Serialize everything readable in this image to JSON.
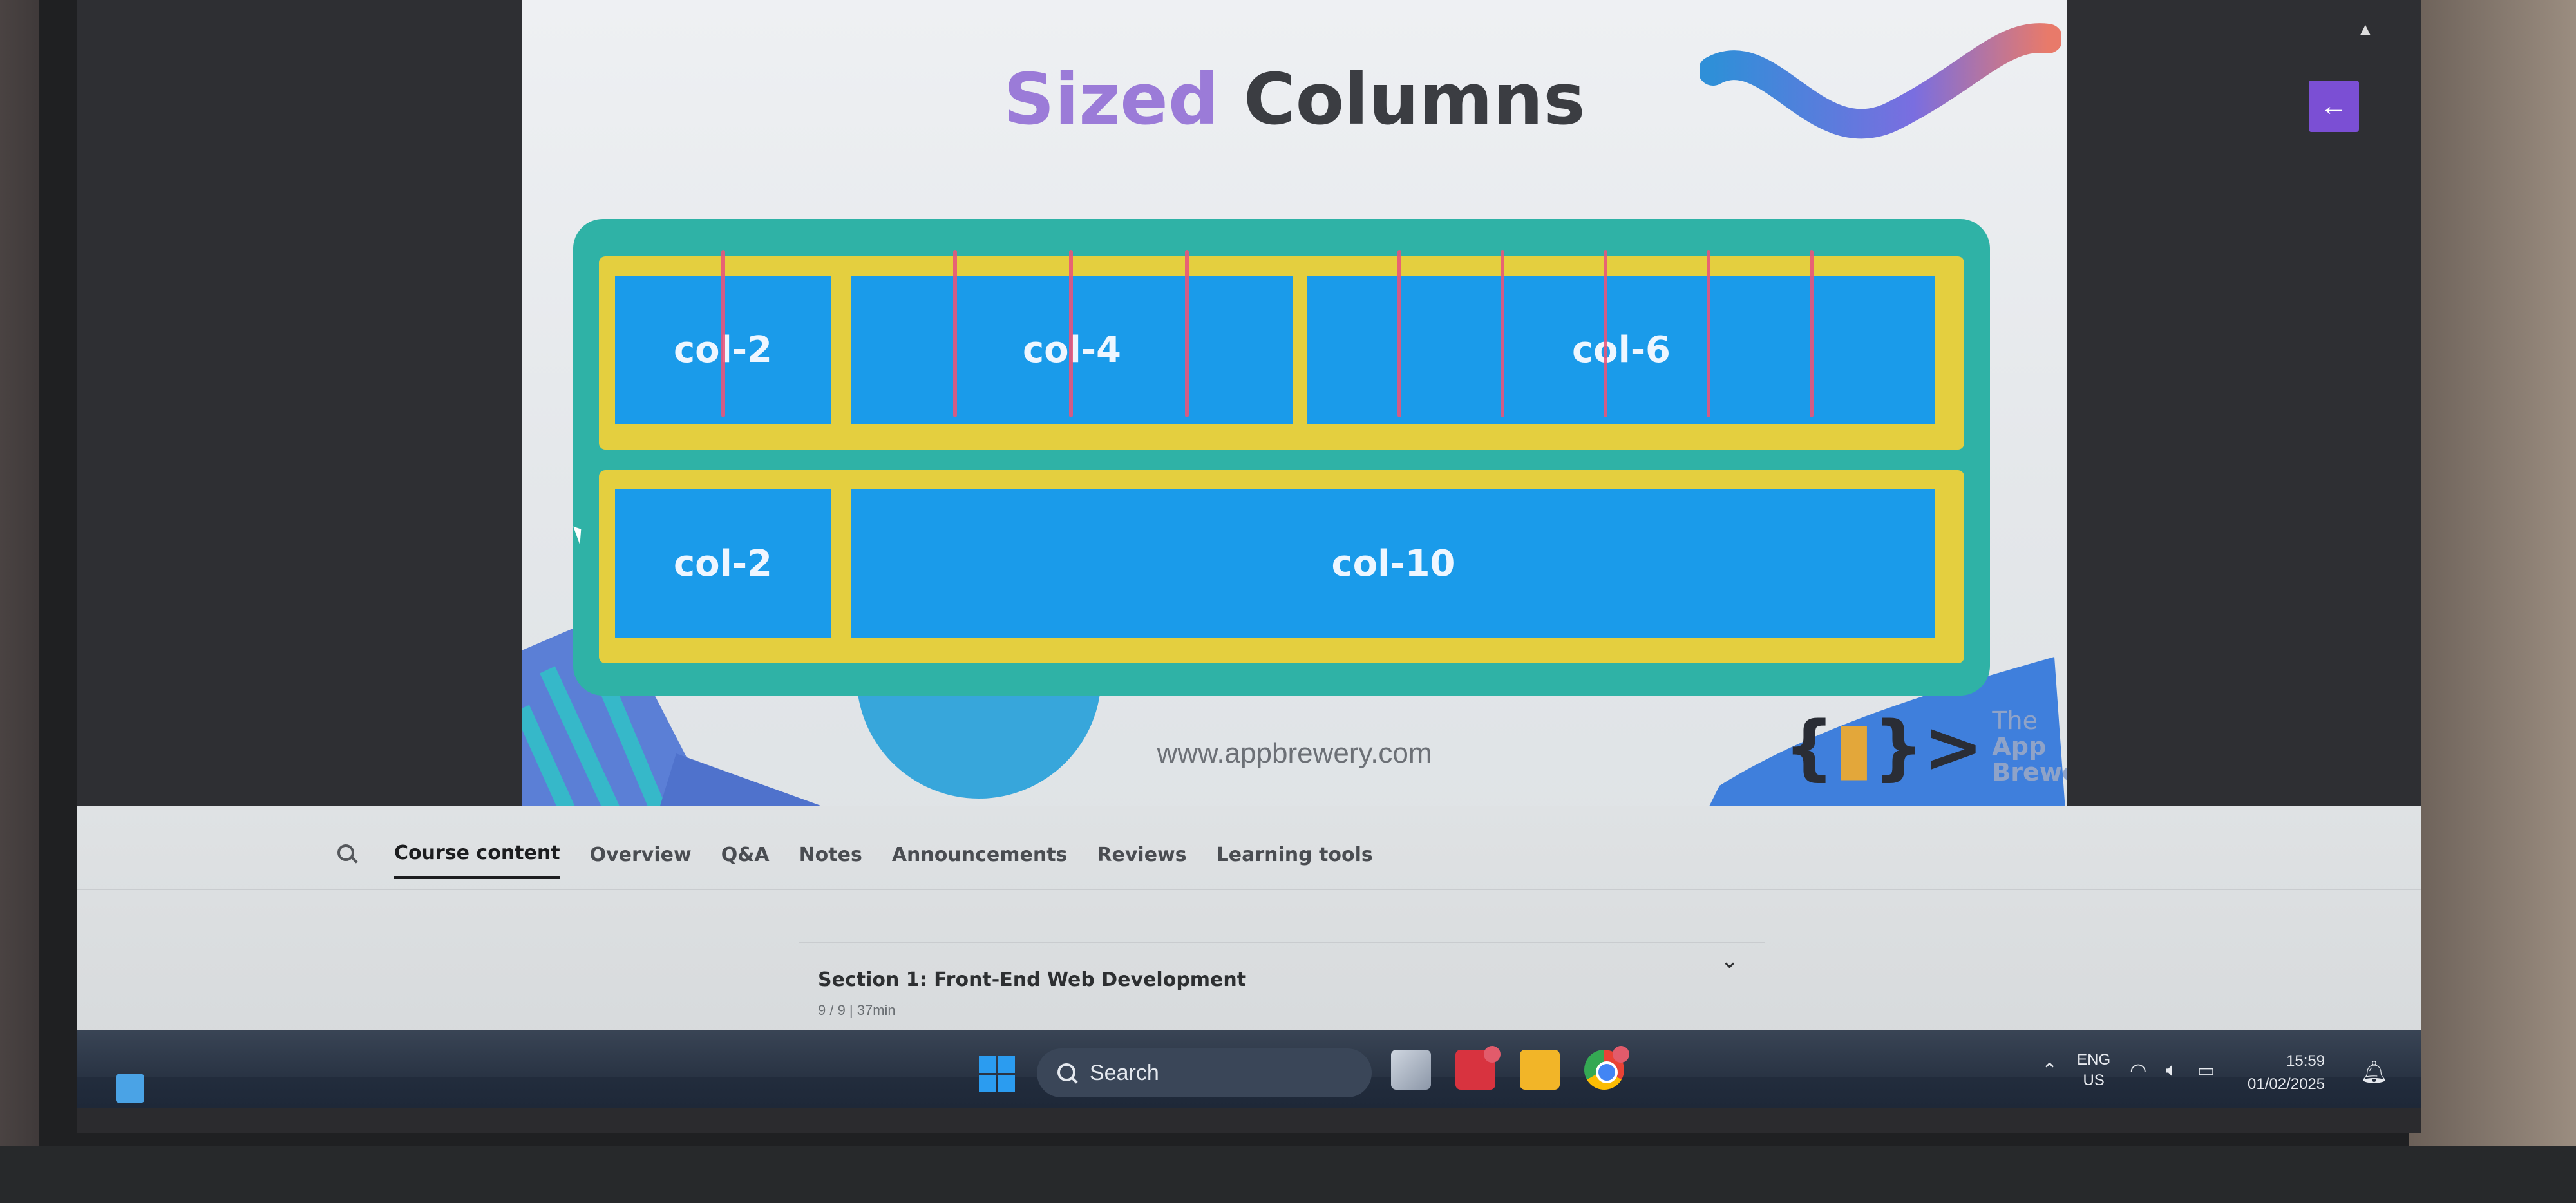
{
  "slide": {
    "title_accent": "Sized",
    "title_rest": "Columns",
    "rows": [
      [
        {
          "label": "col-2"
        },
        {
          "label": "col-4"
        },
        {
          "label": "col-6"
        }
      ],
      [
        {
          "label": "col-2"
        },
        {
          "label": "col-10"
        }
      ]
    ],
    "url": "www.appbrewery.com",
    "brand_line1": "The",
    "brand_line2": "App Brewery",
    "colors": {
      "accent": "#9b7bd8",
      "board": "#2fb2a6",
      "row": "#e4cf3f",
      "column": "#1a9bea"
    }
  },
  "player": {
    "back_icon": "arrow-left-icon",
    "back_symbol": "←"
  },
  "course_tabs": {
    "items": [
      "Course content",
      "Overview",
      "Q&A",
      "Notes",
      "Announcements",
      "Reviews",
      "Learning tools"
    ],
    "active": "Course content"
  },
  "section": {
    "title": "Section 1: Front-End Web Development",
    "meta": "9 / 9 | 37min"
  },
  "taskbar": {
    "search_label": "Search",
    "lang_line1": "ENG",
    "lang_line2": "US",
    "time": "15:59",
    "date": "01/02/2025"
  }
}
